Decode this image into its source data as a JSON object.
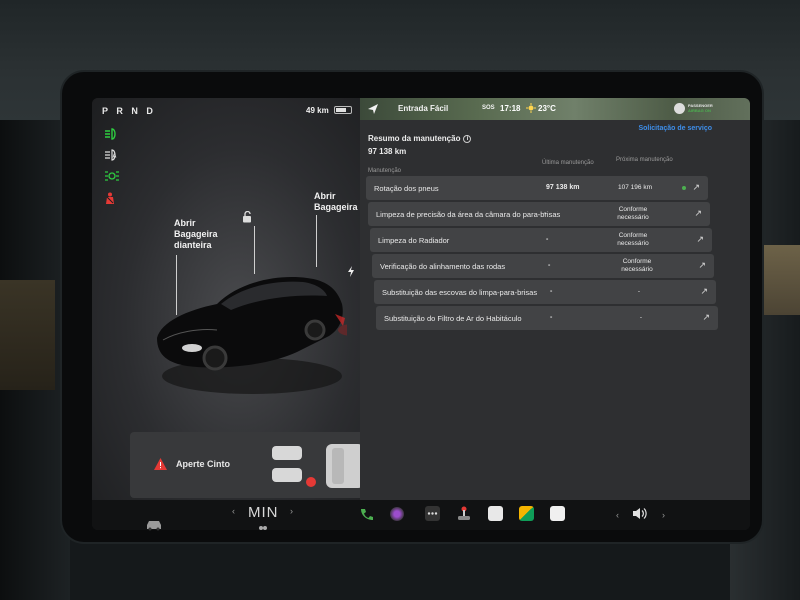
{
  "drive": {
    "gear_display": "P R N D",
    "range": "49 km"
  },
  "status_icons": [
    "headlight-icon",
    "auto-headlight-icon",
    "parking-light-icon",
    "seatbelt-warning-icon"
  ],
  "car_view": {
    "frunk_label": "Abrir\nBagageira\ndianteira",
    "trunk_label": "Abrir\nBagageira"
  },
  "seatbelt": {
    "label": "Aperte Cinto"
  },
  "map": {
    "location": "Entrada Fácil",
    "sos": "SOS",
    "time": "17:18",
    "temperature": "23°C",
    "user_line1": "Passenger",
    "user_line2": "Airbag On"
  },
  "service": {
    "title": "Resumo da manutenção",
    "odometer": "97 138  km",
    "request_link": "Solicitação de serviço",
    "col_name": "Manutenção",
    "col_last": "Última manutenção",
    "col_next": "Próxima manutenção",
    "rows": [
      {
        "name": "Rotação dos pneus",
        "last": "97 138 km",
        "next": "107 196 km"
      },
      {
        "name": "Limpeza de precisão da área da câmara do para-brisas",
        "last": "-",
        "next": "Conforme\nnecessário"
      },
      {
        "name": "Limpeza do Radiador",
        "last": "-",
        "next": "Conforme\nnecessário"
      },
      {
        "name": "Verificação do alinhamento das rodas",
        "last": "-",
        "next": "Conforme\nnecessário"
      },
      {
        "name": "Substituição das escovas do limpa-para-brisas",
        "last": "-",
        "next": "-"
      },
      {
        "name": "Substituição do Filtro de Ar do Habitáculo",
        "last": "-",
        "next": "-"
      }
    ]
  },
  "climate": {
    "setting": "MIN"
  },
  "colors": {
    "accent_blue": "#3e8eea",
    "warning_red": "#e53935",
    "indicator_green": "#2ecc40"
  }
}
